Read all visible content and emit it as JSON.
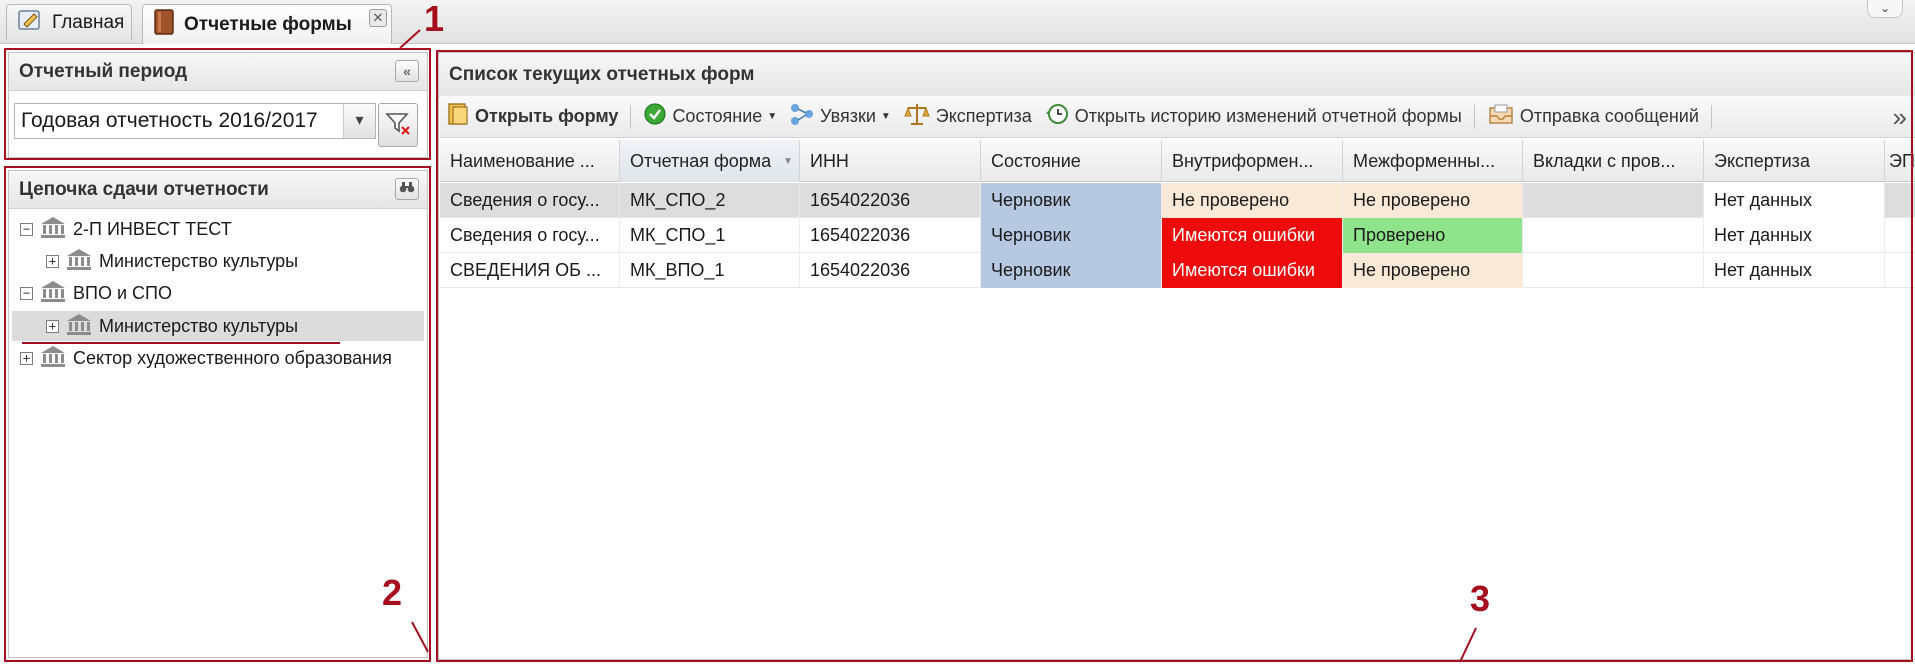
{
  "tabs": [
    {
      "label": "Главная"
    },
    {
      "label": "Отчетные формы"
    }
  ],
  "period_panel": {
    "title": "Отчетный период",
    "selected": "Годовая отчетность 2016/2017"
  },
  "tree_panel": {
    "title": "Цепочка сдачи отчетности",
    "nodes": [
      {
        "label": "2-П ИНВЕСТ ТЕСТ",
        "toggle": "−"
      },
      {
        "label": "Министерство культуры",
        "toggle": "+"
      },
      {
        "label": "ВПО и СПО",
        "toggle": "−"
      },
      {
        "label": "Министерство культуры",
        "toggle": "+"
      },
      {
        "label": "Сектор художественного образования",
        "toggle": "+"
      }
    ]
  },
  "grid_panel": {
    "title": "Список текущих отчетных форм",
    "toolbar": {
      "open": "Открыть форму",
      "state": "Состояние",
      "links": "Увязки",
      "expertise": "Экспертиза",
      "history": "Открыть историю изменений отчетной формы",
      "messages": "Отправка сообщений",
      "more": "»"
    },
    "columns": [
      "Наименование ...",
      "Отчетная форма",
      "ИНН",
      "Состояние",
      "Внутриформен...",
      "Межформенны...",
      "Вкладки с пров...",
      "Экспертиза",
      "ЭП"
    ],
    "rows": [
      [
        "Сведения о госу...",
        "МК_СПО_2",
        "1654022036",
        "Черновик",
        "Не проверено",
        "Не проверено",
        "",
        "Нет данных"
      ],
      [
        "Сведения о госу...",
        "МК_СПО_1",
        "1654022036",
        "Черновик",
        "Имеются ошибки",
        "Проверено",
        "",
        "Нет данных"
      ],
      [
        "СВЕДЕНИЯ ОБ ...",
        "МК_ВПО_1",
        "1654022036",
        "Черновик",
        "Имеются ошибки",
        "Не проверено",
        "",
        "Нет данных"
      ]
    ]
  },
  "annotations": [
    "1",
    "2",
    "3"
  ],
  "colors": {
    "annotation": "#a50e1e",
    "state_draft": "#b7c9e2",
    "not_checked": "#fbe9d8",
    "has_errors": "#ee0b0b",
    "checked": "#8ee38b"
  }
}
